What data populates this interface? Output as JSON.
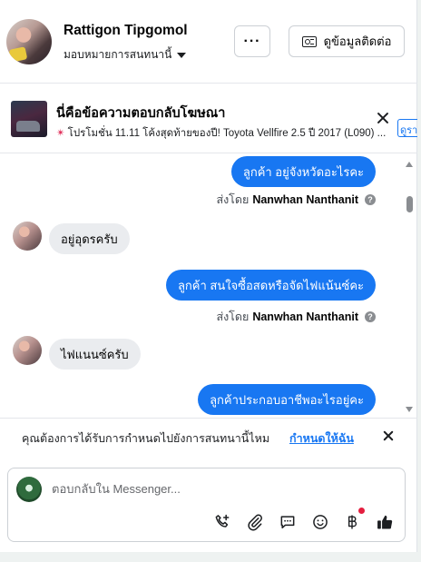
{
  "header": {
    "contact_name": "Rattigon Tipgomol",
    "assign_label": "มอบหมายการสนทนานี้",
    "more_label": "···",
    "contact_info_label": "ดูข้อมูลติดต่อ"
  },
  "ad_reply": {
    "title": "นี่คือข้อความตอบกลับโฆษณา",
    "subtitle": "โปรโมชั่น 11.11 โค้งสุดท้ายของปี! Toyota Vellfire 2.5 ปี 2017 (L090) ...",
    "peek_text": "ดูรา"
  },
  "messages": [
    {
      "type": "outgoing",
      "text": "ลูกค้า  อยู่จังหวัดอะไรคะ"
    },
    {
      "type": "sent_by",
      "prefix": "ส่งโดย",
      "name": "Nanwhan Nanthanit"
    },
    {
      "type": "incoming",
      "text": "อยู่อุดรครับ"
    },
    {
      "type": "outgoing",
      "text": "ลูกค้า สนใจซื้อสดหรือจัดไฟแน้นซ์คะ"
    },
    {
      "type": "sent_by",
      "prefix": "ส่งโดย",
      "name": "Nanwhan Nanthanit"
    },
    {
      "type": "incoming",
      "text": "ไฟแนนซ์ครับ"
    },
    {
      "type": "outgoing",
      "text": "ลูกค้าประกอบอาชีพอะไรอยู่คะ"
    }
  ],
  "assignment_prompt": {
    "text": "คุณต้องการได้รับการกำหนดไปยังการสนทนานี้ไหม",
    "link": "กำหนดให้ฉัน"
  },
  "composer": {
    "placeholder": "ตอบกลับใน Messenger..."
  },
  "icons": [
    "phone-add-icon",
    "paperclip-icon",
    "chat-bubble-icon",
    "emoji-icon",
    "baht-icon",
    "thumbs-up-icon"
  ],
  "colors": {
    "accent": "#1877f2",
    "incoming_bubble": "#eaecef",
    "notification_dot": "#e41e3f"
  }
}
